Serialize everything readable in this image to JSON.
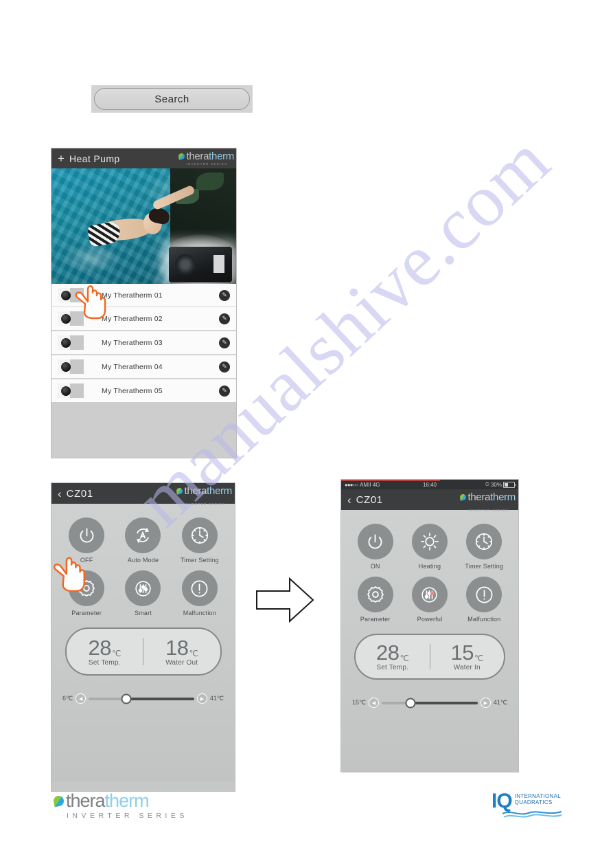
{
  "search": {
    "label": "Search"
  },
  "list_screen": {
    "app_bar": {
      "add_icon": "plus-icon",
      "title": "Heat Pump",
      "brand_part1": "thera",
      "brand_part2": "therm",
      "brand_sub": "INVERTER SERIES"
    },
    "devices": [
      {
        "name": "My Theratherm 01",
        "edit_icon": "edit-icon"
      },
      {
        "name": "My Theratherm 02",
        "edit_icon": "edit-icon"
      },
      {
        "name": "My Theratherm 03",
        "edit_icon": "edit-icon"
      },
      {
        "name": "My Theratherm 04",
        "edit_icon": "edit-icon"
      },
      {
        "name": "My Theratherm 05",
        "edit_icon": "edit-icon"
      }
    ]
  },
  "control_left": {
    "app_bar": {
      "back_icon": "back-chevron-icon",
      "title": "CZ01",
      "brand_part1": "thera",
      "brand_part2": "therm",
      "brand_sub": "INVERTER SERIES"
    },
    "buttons": [
      {
        "label": "OFF",
        "icon": "power-icon"
      },
      {
        "label": "Auto Mode",
        "icon": "auto-mode-icon"
      },
      {
        "label": "Timer Setting",
        "icon": "clock-icon"
      },
      {
        "label": "Parameter",
        "icon": "gear-icon"
      },
      {
        "label": "Smart",
        "icon": "sliders-icon"
      },
      {
        "label": "Malfunction",
        "icon": "alert-icon"
      }
    ],
    "temps": [
      {
        "value": "28",
        "unit": "℃",
        "caption": "Set Temp."
      },
      {
        "value": "18",
        "unit": "℃",
        "caption": "Water Out"
      }
    ],
    "slider": {
      "min_label": "6℃",
      "max_label": "41℃",
      "left_arrow": "left-arrow-icon",
      "right_arrow": "right-arrow-icon",
      "thumb_percent": 36
    }
  },
  "control_right": {
    "status_bar": {
      "signal": "●●●○○",
      "carrier": "AMII  4G",
      "time": "16:40",
      "battery_percent": "30%",
      "alarm_icon": "alarm-icon"
    },
    "app_bar": {
      "back_icon": "back-chevron-icon",
      "title": "CZ01",
      "brand_part1": "thera",
      "brand_part2": "therm",
      "brand_sub": "INVERTER SERIES"
    },
    "buttons": [
      {
        "label": "ON",
        "icon": "power-icon"
      },
      {
        "label": "Heating",
        "icon": "sun-icon"
      },
      {
        "label": "Timer Setting",
        "icon": "clock-icon"
      },
      {
        "label": "Parameter",
        "icon": "gear-icon"
      },
      {
        "label": "Powerful",
        "icon": "sliders-icon"
      },
      {
        "label": "Malfunction",
        "icon": "alert-icon"
      }
    ],
    "temps": [
      {
        "value": "28",
        "unit": "℃",
        "caption": "Set Temp."
      },
      {
        "value": "15",
        "unit": "℃",
        "caption": "Water In"
      }
    ],
    "slider": {
      "min_label": "15℃",
      "max_label": "41℃",
      "left_arrow": "left-arrow-icon",
      "right_arrow": "right-arrow-icon",
      "thumb_percent": 30
    }
  },
  "flow_arrow": {
    "icon": "right-arrow-outline-icon"
  },
  "footer": {
    "theratherm": {
      "part1": "thera",
      "part2": "therm",
      "sub": "INVERTER SERIES"
    },
    "iq": {
      "mark": "IQ",
      "line1": "INTERNATIONAL",
      "line2": "QUADRATICS"
    }
  },
  "watermark": {
    "text": "manualshive.com"
  },
  "colors": {
    "brand_blue": "#8fcfe8",
    "brand_gray": "#7d8083",
    "iq_blue": "#1f7fc4",
    "hand_orange": "#f26722",
    "app_bar_dark": "#3b3d3f"
  }
}
